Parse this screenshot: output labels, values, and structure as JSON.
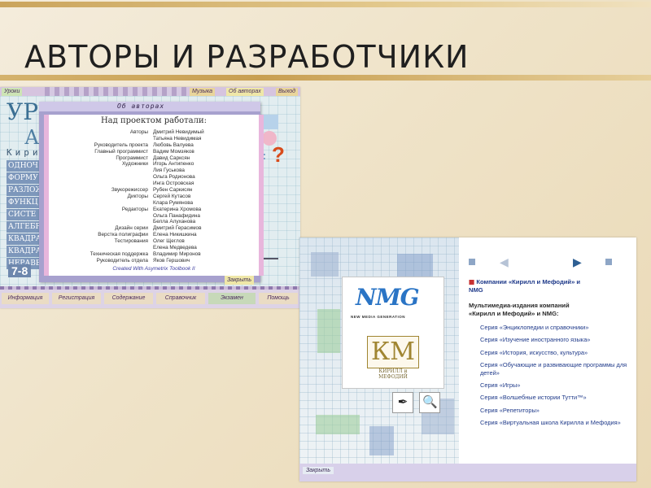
{
  "slide": {
    "title": "АВТОРЫ И РАЗРАБОТЧИКИ"
  },
  "screenshot1": {
    "top_tabs": [
      "Уроки",
      "Музыка",
      "Об авторах",
      "Выход"
    ],
    "big_title": "УР",
    "big_letter": "А",
    "kirill_label": "Кири",
    "left_menu": [
      "ОДНОЧ",
      "ФОРМУ",
      "РАЗЛОЖ",
      "ФУНКЦ",
      "СИСТЕ",
      "АЛГЕБР",
      "КВАДРА",
      "КВАДРА",
      "НЕРАВЕ"
    ],
    "grade": "7-8",
    "eq_symbol": "=",
    "question_mark": "?",
    "bottom_buttons": [
      "Информация",
      "Регистрация",
      "Содержание",
      "Справочник",
      "Экзамен",
      "Помощь"
    ],
    "close_label": "Закрыть",
    "dialog": {
      "title": "Об авторах",
      "heading": "Над проектом работали:",
      "credits": [
        {
          "role": "Авторы",
          "name": "Дмитрий Невидимый"
        },
        {
          "role": "",
          "name": "Татьяна Невидимая"
        },
        {
          "role": "Руководитель проекта",
          "name": "Любовь Валуева"
        },
        {
          "role": "Главный программист",
          "name": "Вадим Момзяков"
        },
        {
          "role": "Программист",
          "name": "Давид Сарксян"
        },
        {
          "role": "Художники",
          "name": "Игорь Антипенко"
        },
        {
          "role": "",
          "name": "Лия Гуськова"
        },
        {
          "role": "",
          "name": "Ольга Родионова"
        },
        {
          "role": "",
          "name": "Инга Островская"
        },
        {
          "role": "Звукорежиссер",
          "name": "Рубен Саркисян"
        },
        {
          "role": "Дикторы",
          "name": "Сергей Кутасов"
        },
        {
          "role": "",
          "name": "Клара Румянова"
        },
        {
          "role": "Редакторы",
          "name": "Екатерина Хромова"
        },
        {
          "role": "",
          "name": "Ольга Панафидина"
        },
        {
          "role": "",
          "name": "Белла Алуханова"
        },
        {
          "role": "Дизайн серии",
          "name": "Дмитрий Герасимов"
        },
        {
          "role": "Верстка полиграфии",
          "name": "Елена Никишкина"
        },
        {
          "role": "Тестирования",
          "name": "Олег Щеглов"
        },
        {
          "role": "",
          "name": "Елена Медведева"
        },
        {
          "role": "Техническая поддержка",
          "name": "Владимир Миронов"
        },
        {
          "role": "Руководитель отдела",
          "name": "Яков Гершович"
        }
      ],
      "created_with": "Created With Asymetrix Toolbook II"
    }
  },
  "screenshot2": {
    "nmg_logo": "NMG",
    "nmg_caption": "NEW MEDIA GENERATION",
    "km_logo": "КМ",
    "km_caption_1": "КИРИЛЛ и",
    "km_caption_2": "МЕФОДИЙ",
    "tool_pen_icon": "✒",
    "tool_search_icon": "🔍",
    "nav_prev": "◀",
    "nav_next": "▶",
    "companies_line_1": "Компании «Кирилл и Мефодий» и",
    "companies_line_2": "NMG",
    "intro_line_1": "Мультимедиа-издания компаний",
    "intro_line_2": "«Кирилл и Мефодий» и NMG:",
    "series": [
      "Серия «Энциклопедии и справочники»",
      "Серия «Изучение иностранного языка»",
      "Серия «История, искусство, культура»",
      "Серия «Обучающие и развивающие программы для детей»",
      "Серия «Игры»",
      "Серия «Волшебные истории Тутти™»",
      "Серия «Репетиторы»",
      "Серия «Виртуальная школа Кирилла и Мефодия»"
    ],
    "close_label": "Закрыть"
  }
}
